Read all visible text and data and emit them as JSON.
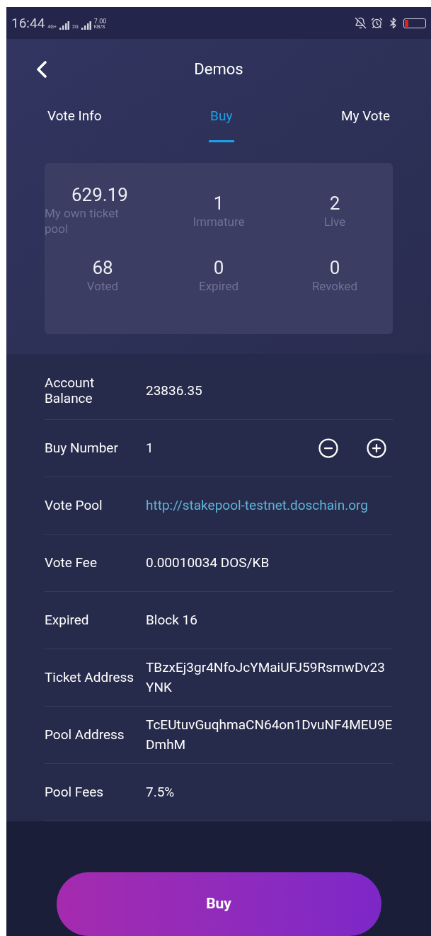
{
  "status_bar": {
    "time": "16:44",
    "network_1": "4G+",
    "network_2": "2G",
    "speed": "7.00",
    "speed_unit": "KB/S"
  },
  "header": {
    "title": "Demos"
  },
  "tabs": [
    {
      "label": "Vote Info",
      "selected": false
    },
    {
      "label": "Buy",
      "selected": true
    },
    {
      "label": "My Vote",
      "selected": false
    }
  ],
  "stats": [
    {
      "value": "629.19",
      "label": "My own ticket pool"
    },
    {
      "value": "1",
      "label": "Immature"
    },
    {
      "value": "2",
      "label": "Live"
    },
    {
      "value": "68",
      "label": "Voted"
    },
    {
      "value": "0",
      "label": "Expired"
    },
    {
      "value": "0",
      "label": "Revoked"
    }
  ],
  "rows": [
    {
      "kind": "text",
      "label": "Account Balance",
      "value": "23836.35"
    },
    {
      "kind": "stepper",
      "label": "Buy Number",
      "value": "1"
    },
    {
      "kind": "link",
      "label": "Vote Pool",
      "value": "http://stakepool-testnet.doschain.org"
    },
    {
      "kind": "text",
      "label": "Vote Fee",
      "value": "0.00010034 DOS/KB"
    },
    {
      "kind": "text",
      "label": "Expired",
      "value": "Block 16"
    },
    {
      "kind": "text",
      "label": "Ticket Address",
      "value": "TBzxEj3gr4NfoJcYMaiUFJ59RsmwDv23YNK"
    },
    {
      "kind": "text",
      "label": "Pool Address",
      "value": "TcEUtuvGuqhmaCN64on1DvuNF4MEU9EDmhM"
    },
    {
      "kind": "text",
      "label": "Pool Fees",
      "value": "7.5%"
    }
  ],
  "buy_button": "Buy"
}
